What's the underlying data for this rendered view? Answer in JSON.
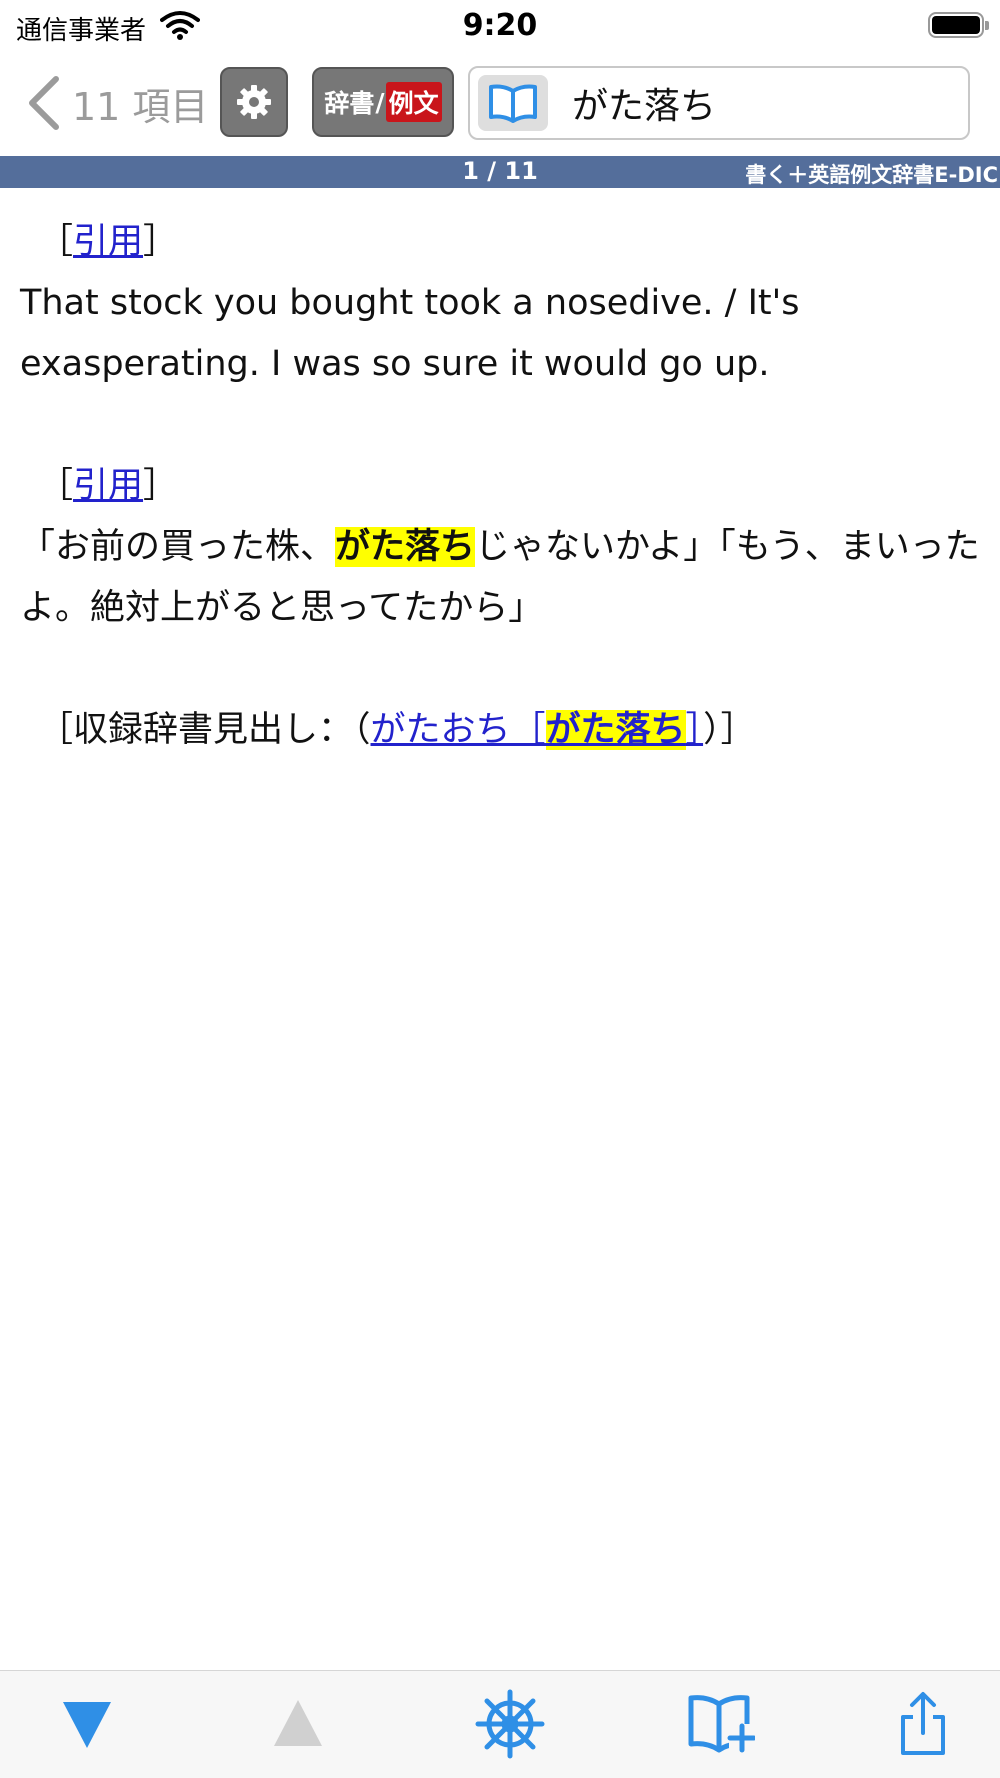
{
  "status": {
    "carrier": "通信事業者",
    "time": "9:20"
  },
  "toolbar": {
    "back_label": "11 項目",
    "dict_button": {
      "part1": "辞書",
      "slash": "/",
      "part2": "例文"
    },
    "search_value": "がた落ち"
  },
  "info_bar": {
    "page_count": "1 / 11",
    "dictionary_name": "書く＋英語例文辞書E-DIC"
  },
  "content": {
    "entry1": {
      "open_bracket": "［",
      "link": "引用",
      "close_bracket": "］",
      "text": "That stock you bought took a nosedive. / It's exasperating. I was so sure it would go up."
    },
    "entry2": {
      "open_bracket": "［",
      "link": "引用",
      "close_bracket": "］",
      "text_before": "「お前の買った株、",
      "highlight": "がた落ち",
      "text_after": "じゃないかよ」「もう、まいったよ。絶対上がると思ってたから」"
    },
    "headword": {
      "prefix": "［収録辞書見出し：（",
      "link_reading": "がたおち［",
      "link_highlight": "がた落ち",
      "link_close": "］",
      "suffix": "）］"
    }
  },
  "bottom_bar": {
    "icons": [
      "triangle-down-icon",
      "triangle-up-icon",
      "helm-icon",
      "book-add-icon",
      "share-icon"
    ]
  },
  "colors": {
    "accent": "#2f8fe6",
    "info_bar": "#546e9b",
    "link": "#2222cc",
    "highlight": "#ffff00",
    "disabled": "#d0d0d0",
    "red_label": "#c9151b"
  }
}
